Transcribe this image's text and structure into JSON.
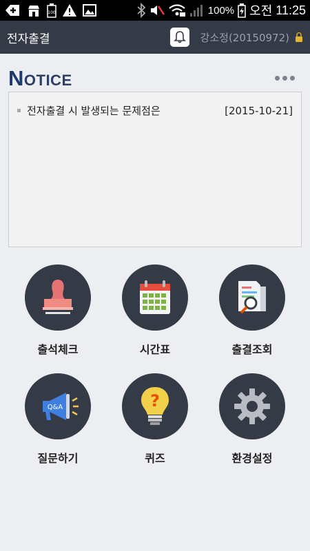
{
  "status_bar": {
    "battery_percent": "100%",
    "period": "오전",
    "time": "11:25"
  },
  "app_bar": {
    "title": "전자출결",
    "user": "강소정(20150972)"
  },
  "notice": {
    "title_first": "N",
    "title_rest": "OTICE",
    "items": [
      {
        "title": "전자출결 시 발생되는 문제점은",
        "date": "[2015-10-21]"
      }
    ]
  },
  "menu": [
    {
      "label": "출석체크",
      "icon": "stamp-icon"
    },
    {
      "label": "시간표",
      "icon": "calendar-icon"
    },
    {
      "label": "출결조회",
      "icon": "document-search-icon"
    },
    {
      "label": "질문하기",
      "icon": "megaphone-qa-icon"
    },
    {
      "label": "퀴즈",
      "icon": "lightbulb-question-icon"
    },
    {
      "label": "환경설정",
      "icon": "gear-icon"
    }
  ],
  "colors": {
    "app_bar": "#353a47",
    "background": "#eceef1",
    "circle": "#353a47",
    "notice_title": "#1f3a6e"
  }
}
